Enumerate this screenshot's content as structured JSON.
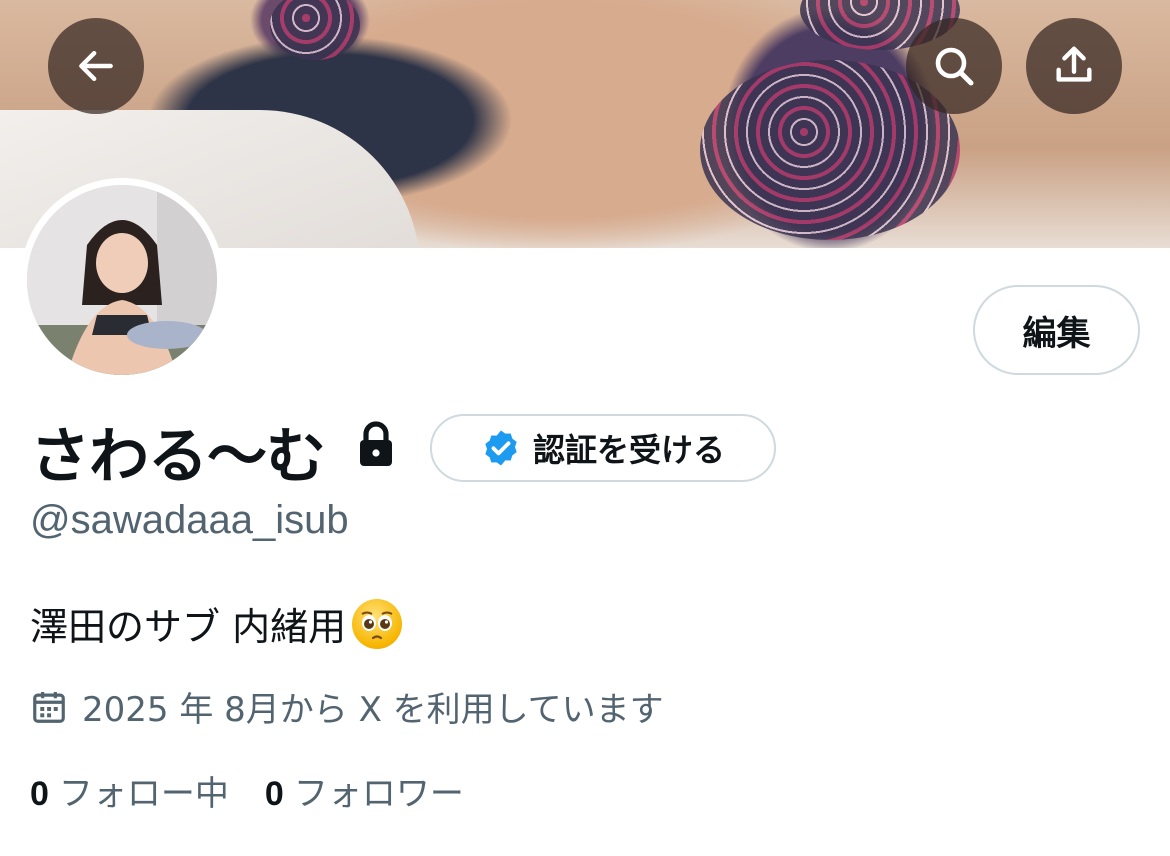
{
  "profile": {
    "display_name": "さわる〜む",
    "handle": "@sawadaaa_isub",
    "bio": "澤田のサブ 内緒用",
    "bio_emoji": "pleading-face-emoji",
    "joined": "2025 年 8月から X を利用しています",
    "following_count": "0",
    "following_label": "フォロー中",
    "followers_count": "0",
    "followers_label": "フォロワー"
  },
  "actions": {
    "edit_label": "編集",
    "verify_label": "認証を受ける"
  },
  "icons": {
    "back": "arrow-left-icon",
    "search": "search-icon",
    "share": "share-icon",
    "lock": "lock-icon",
    "verified": "verified-badge-icon",
    "calendar": "calendar-icon"
  },
  "colors": {
    "text_primary": "#0f1419",
    "text_secondary": "#536471",
    "border": "#cfd9de",
    "verified_blue": "#1d9bf0"
  }
}
